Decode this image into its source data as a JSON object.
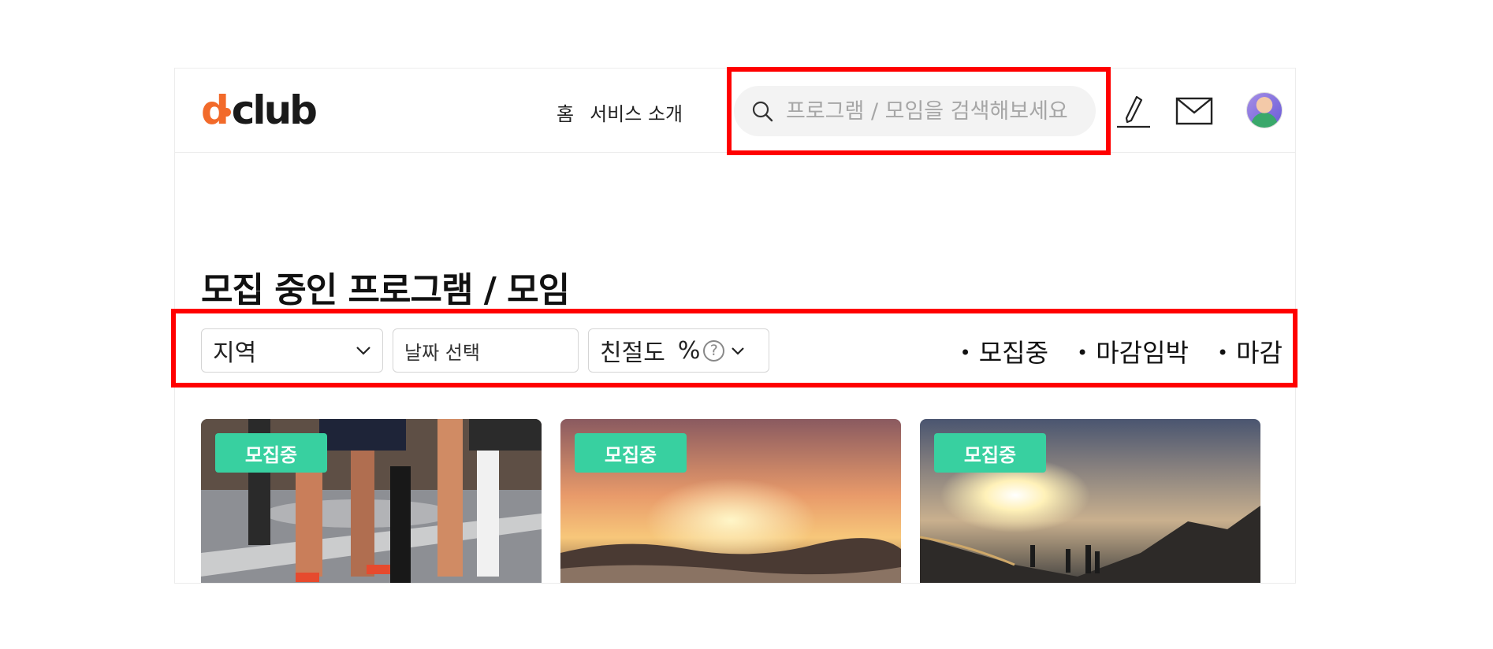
{
  "header": {
    "logo_text_d": "d",
    "logo_text_rest": "club",
    "nav": [
      {
        "label": "홈"
      },
      {
        "label": "서비스 소개"
      }
    ],
    "search": {
      "placeholder": "프로그램 / 모임을 검색해보세요",
      "icon": "search-icon"
    },
    "icons": [
      "pen-icon",
      "mail-icon"
    ],
    "avatar_icon": "avatar"
  },
  "main": {
    "title": "모집 중인 프로그램 / 모임",
    "filters": {
      "region_label": "지역",
      "date_placeholder": "날짜 선택",
      "kindness_label": "친절도",
      "kindness_unit": "%",
      "help_symbol": "?"
    },
    "status_options": [
      {
        "label": "모집중"
      },
      {
        "label": "마감임박"
      },
      {
        "label": "마감"
      }
    ],
    "cards": [
      {
        "badge": "모집중",
        "image": "marathon-runners-photo"
      },
      {
        "badge": "모집중",
        "image": "sunset-landscape-photo"
      },
      {
        "badge": "모집중",
        "image": "mountain-hikers-photo"
      }
    ]
  },
  "colors": {
    "accent": "#f26a2a",
    "badge": "#38d0a0",
    "highlight": "#ff0000"
  }
}
